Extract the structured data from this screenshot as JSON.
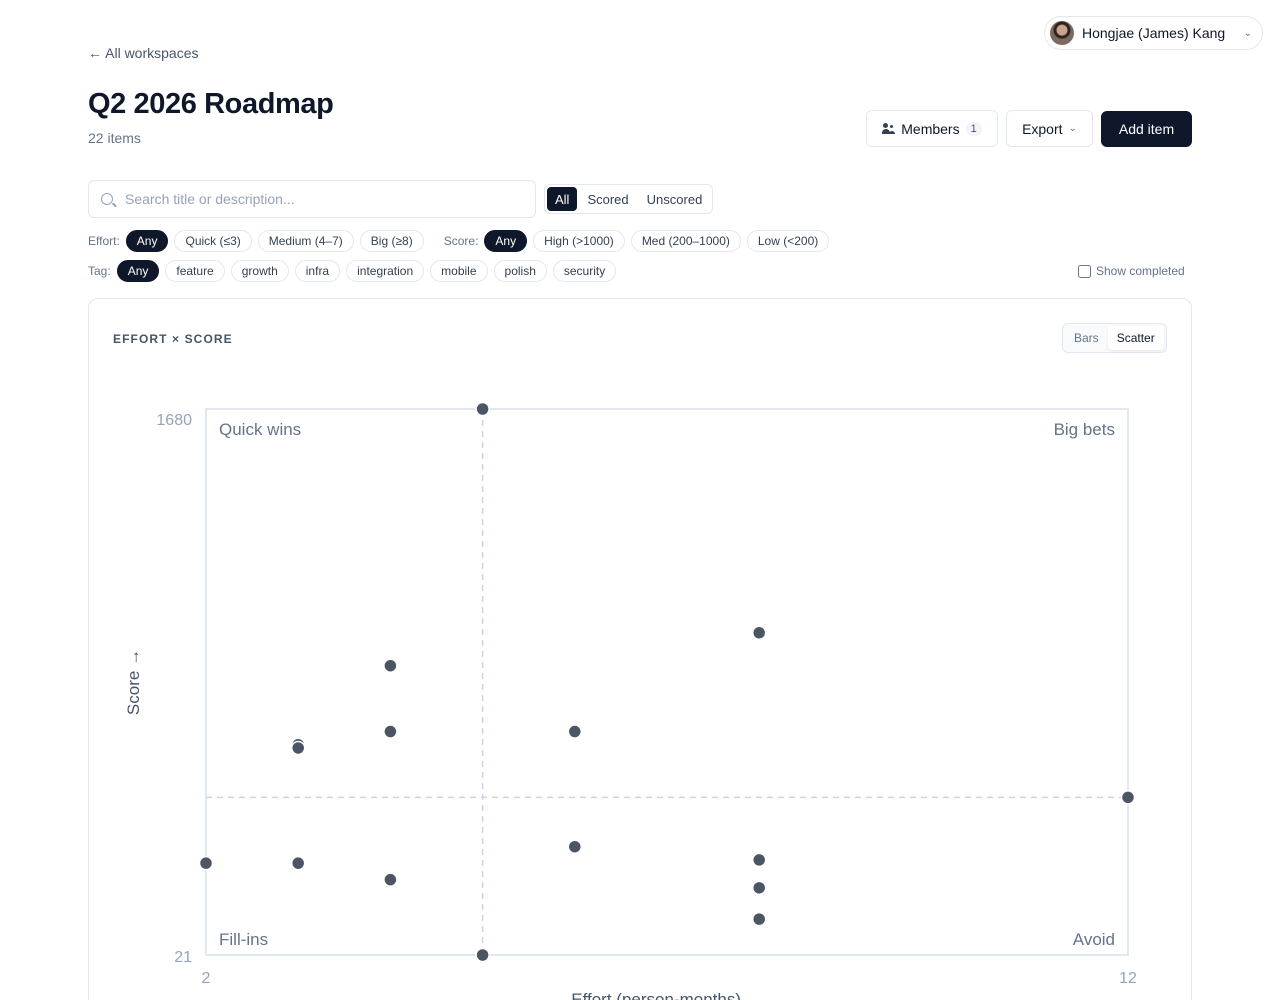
{
  "user": {
    "name": "Hongjae (James) Kang"
  },
  "nav": {
    "back_link": "← All workspaces"
  },
  "header": {
    "title": "Q2 2026 Roadmap",
    "item_count": "22 items",
    "members_label": "Members",
    "members_count": "1",
    "export_label": "Export",
    "add_item_label": "Add item"
  },
  "search": {
    "placeholder": "Search title or description..."
  },
  "score_segment": {
    "options": [
      "All",
      "Scored",
      "Unscored"
    ],
    "active": "All"
  },
  "filters": {
    "effort": {
      "label": "Effort:",
      "options": [
        "Any",
        "Quick (≤3)",
        "Medium (4–7)",
        "Big (≥8)"
      ],
      "active": "Any"
    },
    "score": {
      "label": "Score:",
      "options": [
        "Any",
        "High (>1000)",
        "Med (200–1000)",
        "Low (<200)"
      ],
      "active": "Any"
    },
    "tag": {
      "label": "Tag:",
      "options": [
        "Any",
        "feature",
        "growth",
        "infra",
        "integration",
        "mobile",
        "polish",
        "security"
      ],
      "active": "Any"
    },
    "show_completed": {
      "label": "Show completed",
      "checked": false
    }
  },
  "panel": {
    "title": "EFFORT × SCORE",
    "view_options": [
      "Bars",
      "Scatter"
    ],
    "active_view": "Scatter"
  },
  "chart_data": {
    "type": "scatter",
    "xlabel": "Effort (person-months) →",
    "ylabel": "Score →",
    "xlim": [
      2,
      12
    ],
    "ylim": [
      21,
      1680
    ],
    "x_tick_labels": [
      "2",
      "12"
    ],
    "y_tick_labels": [
      "1680",
      "21"
    ],
    "quadrant_labels": {
      "top_left": "Quick wins",
      "top_right": "Big bets",
      "bottom_left": "Fill-ins",
      "bottom_right": "Avoid"
    },
    "divider": {
      "x": 5,
      "y": 500
    },
    "point_color": "#4b5563",
    "points": [
      {
        "x": 5,
        "y": 1680
      },
      {
        "x": 8,
        "y": 1000
      },
      {
        "x": 4,
        "y": 900
      },
      {
        "x": 3,
        "y": 660
      },
      {
        "x": 3,
        "y": 650
      },
      {
        "x": 4,
        "y": 700
      },
      {
        "x": 6,
        "y": 700
      },
      {
        "x": 12,
        "y": 500
      },
      {
        "x": 2,
        "y": 300
      },
      {
        "x": 3,
        "y": 300
      },
      {
        "x": 4,
        "y": 250
      },
      {
        "x": 6,
        "y": 350
      },
      {
        "x": 8,
        "y": 310
      },
      {
        "x": 8,
        "y": 225
      },
      {
        "x": 8,
        "y": 130
      },
      {
        "x": 5,
        "y": 21
      }
    ]
  }
}
